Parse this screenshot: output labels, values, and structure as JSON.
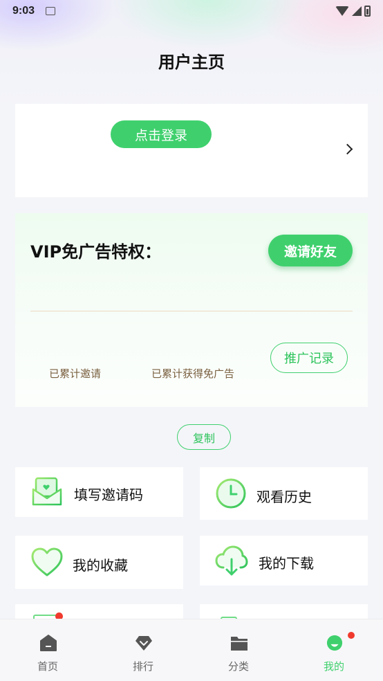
{
  "status_bar": {
    "time": "9:03"
  },
  "header": {
    "title": "用户主页"
  },
  "login_card": {
    "login_label": "点击登录"
  },
  "vip": {
    "title": "VIP免广告特权：",
    "invite_label": "邀请好友",
    "promo_record_label": "推广记录",
    "invited_label": "已累计邀请",
    "earned_label": "已累计获得免广告"
  },
  "copy_label": "复制",
  "tiles": [
    {
      "label": "填写邀请码",
      "icon": "invite-envelope-icon"
    },
    {
      "label": "观看历史",
      "icon": "clock-icon"
    },
    {
      "label": "我的收藏",
      "icon": "heart-icon"
    },
    {
      "label": "我的下载",
      "icon": "cloud-download-icon"
    }
  ],
  "bottom_nav": [
    {
      "label": "首页",
      "icon": "home-icon",
      "active": false
    },
    {
      "label": "排行",
      "icon": "rank-diamond-icon",
      "active": false
    },
    {
      "label": "分类",
      "icon": "folder-icon",
      "active": false
    },
    {
      "label": "我的",
      "icon": "profile-icon",
      "active": true
    }
  ],
  "colors": {
    "accent": "#3fd06d",
    "badge": "#f03a2e",
    "nav_inactive": "#666666"
  }
}
